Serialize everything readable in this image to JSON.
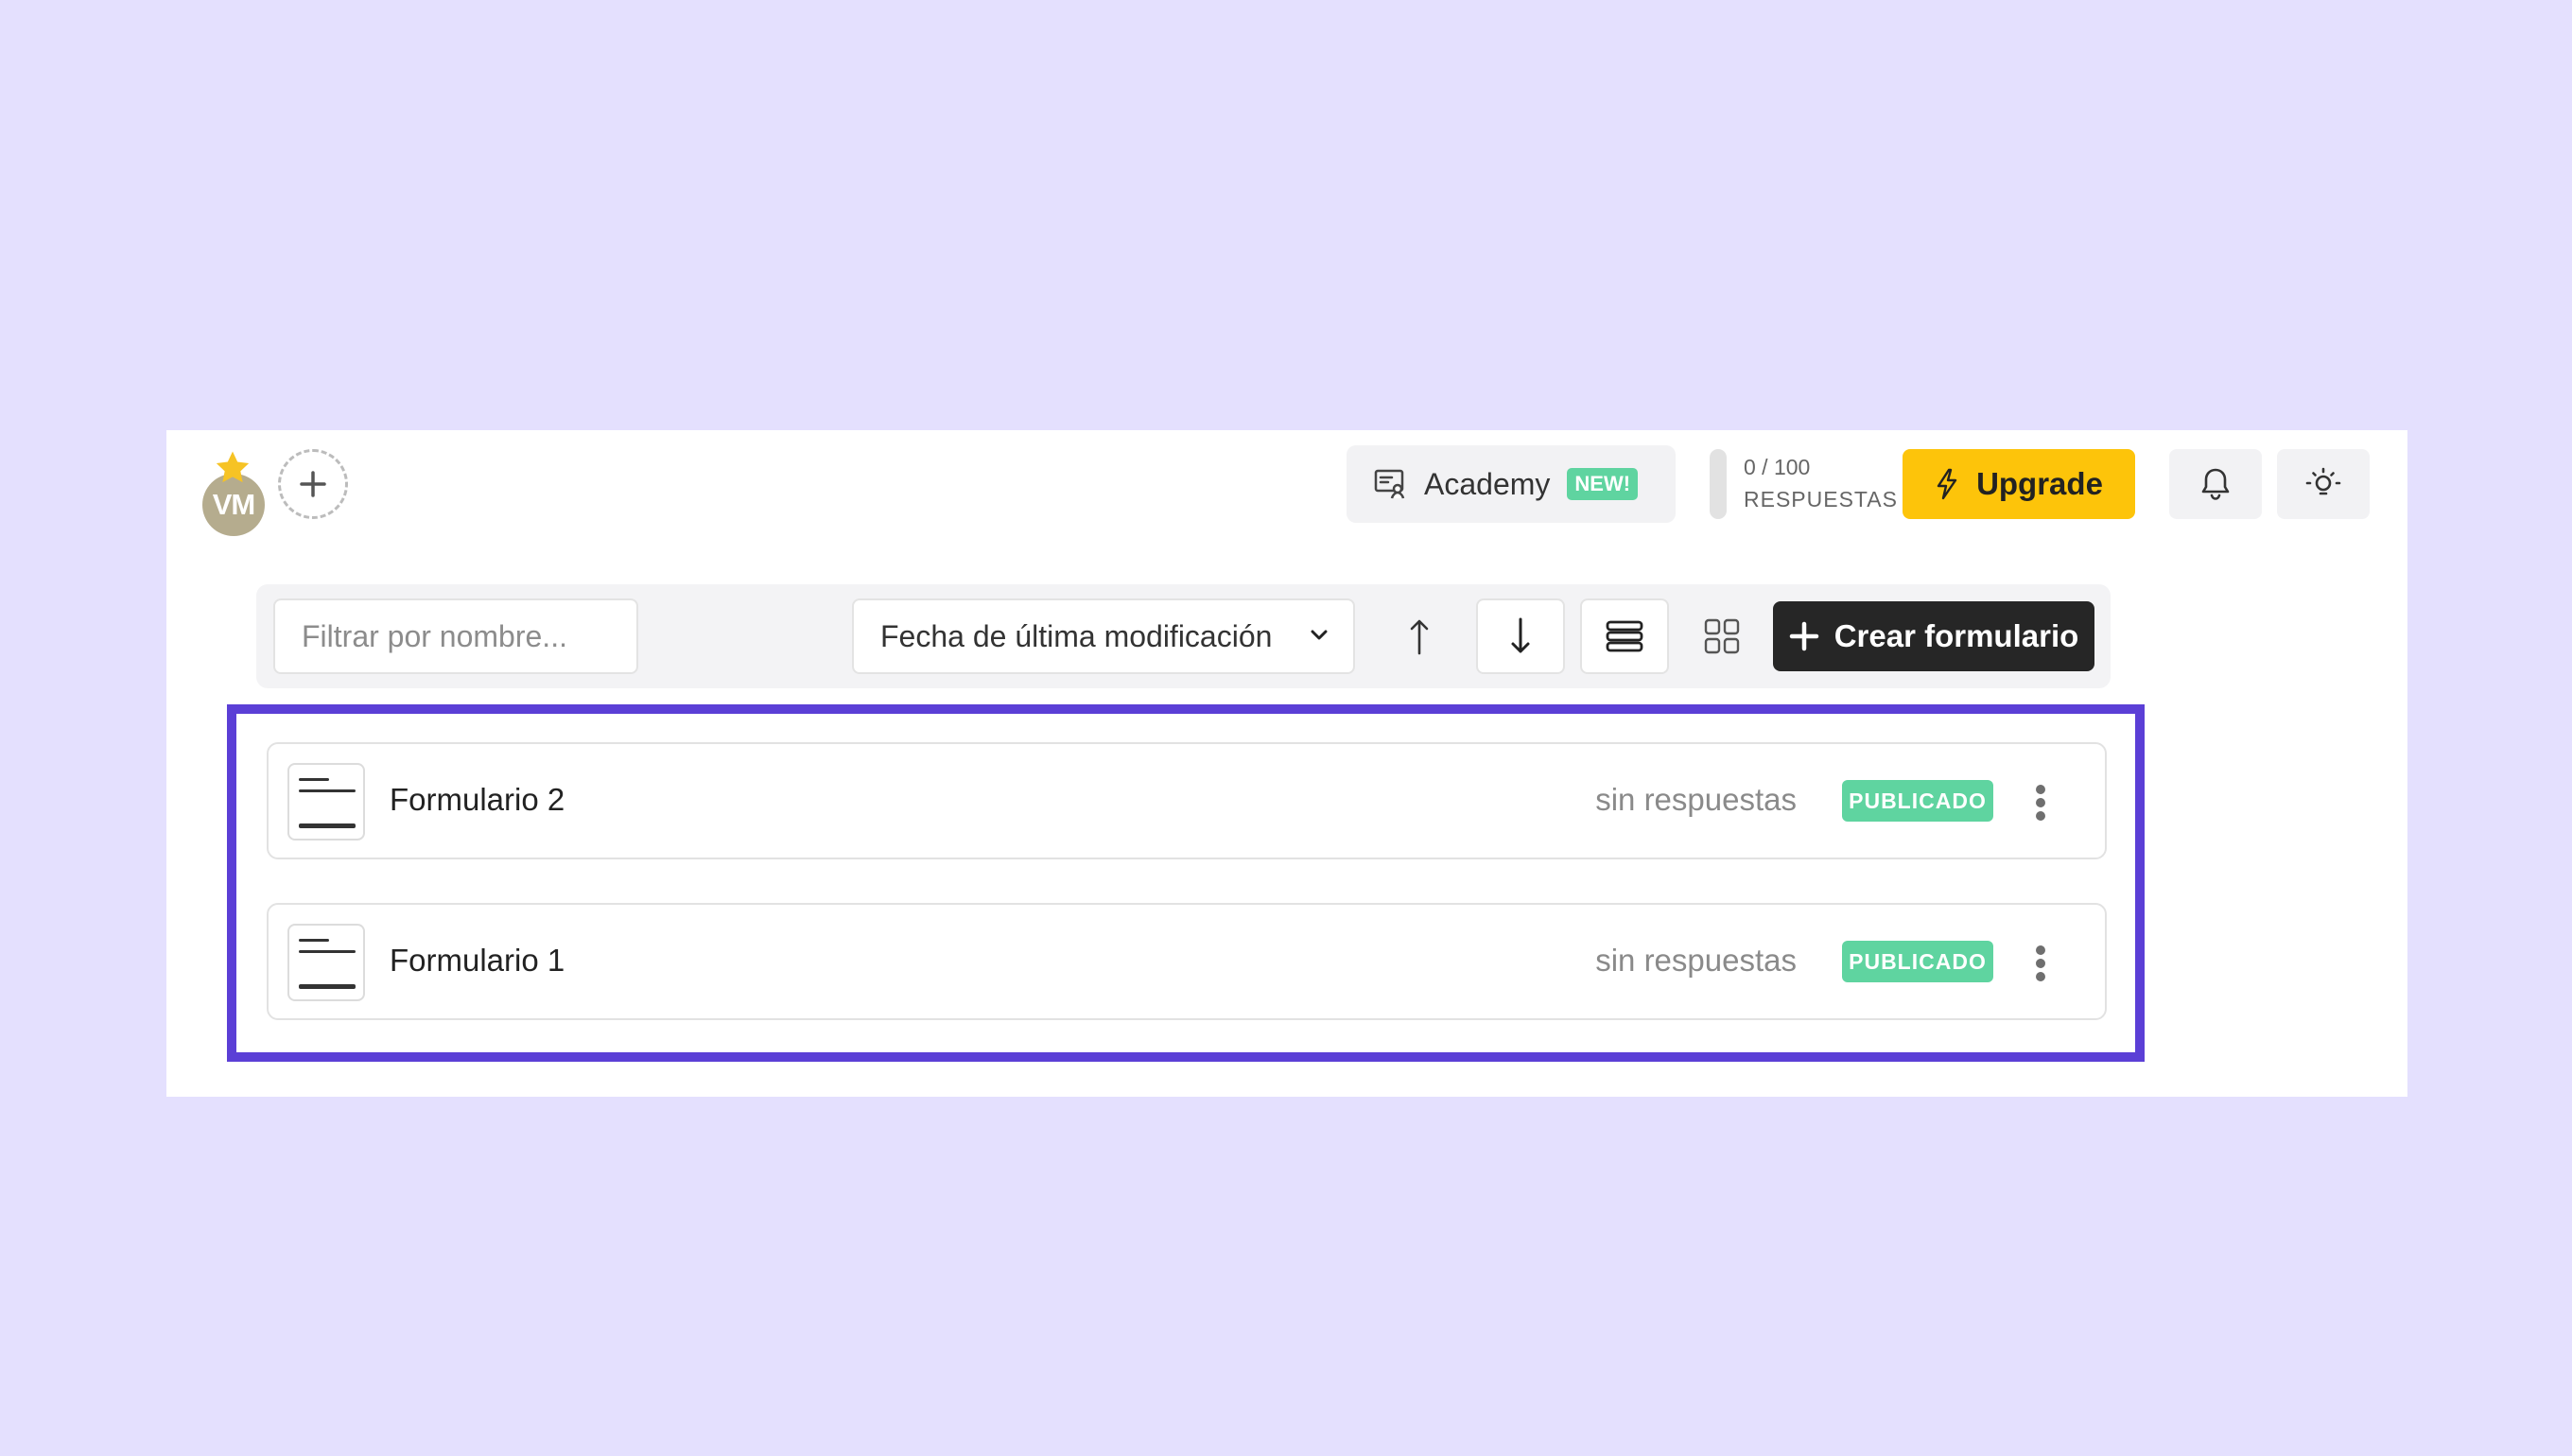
{
  "header": {
    "avatar_initials": "VM",
    "academy_label": "Academy",
    "academy_badge": "NEW!",
    "usage_count": "0 / 100",
    "usage_label": "RESPUESTAS",
    "upgrade_label": "Upgrade",
    "usage_fraction": 0
  },
  "toolbar": {
    "filter_placeholder": "Filtrar por nombre...",
    "sort_value": "Fecha de última modificación",
    "create_label": "Crear formulario"
  },
  "forms": [
    {
      "name": "Formulario 2",
      "responses": "sin respuestas",
      "status": "PUBLICADO"
    },
    {
      "name": "Formulario 1",
      "responses": "sin respuestas",
      "status": "PUBLICADO"
    }
  ],
  "icons": {
    "avatar_badge": "star-icon",
    "add_member": "plus-circle-icon",
    "academy": "presentation-icon",
    "upgrade": "lightning-icon",
    "notifications": "bell-icon",
    "theme": "lightbulb-icon",
    "sort_dropdown": "chevron-down-icon",
    "sort_ascending": "arrow-up-icon",
    "sort_descending": "arrow-down-icon",
    "list_view": "list-view-icon",
    "grid_view": "grid-view-icon",
    "create": "plus-icon",
    "form": "form-icon",
    "form_menu": "more-vertical-icon"
  },
  "colors": {
    "page_background": "#e4e0fe",
    "highlight": "#5b3fd6",
    "upgrade": "#fdc40a",
    "status_published": "#5fd4a0",
    "create_button": "#262626",
    "avatar": "#b5ac8e"
  }
}
